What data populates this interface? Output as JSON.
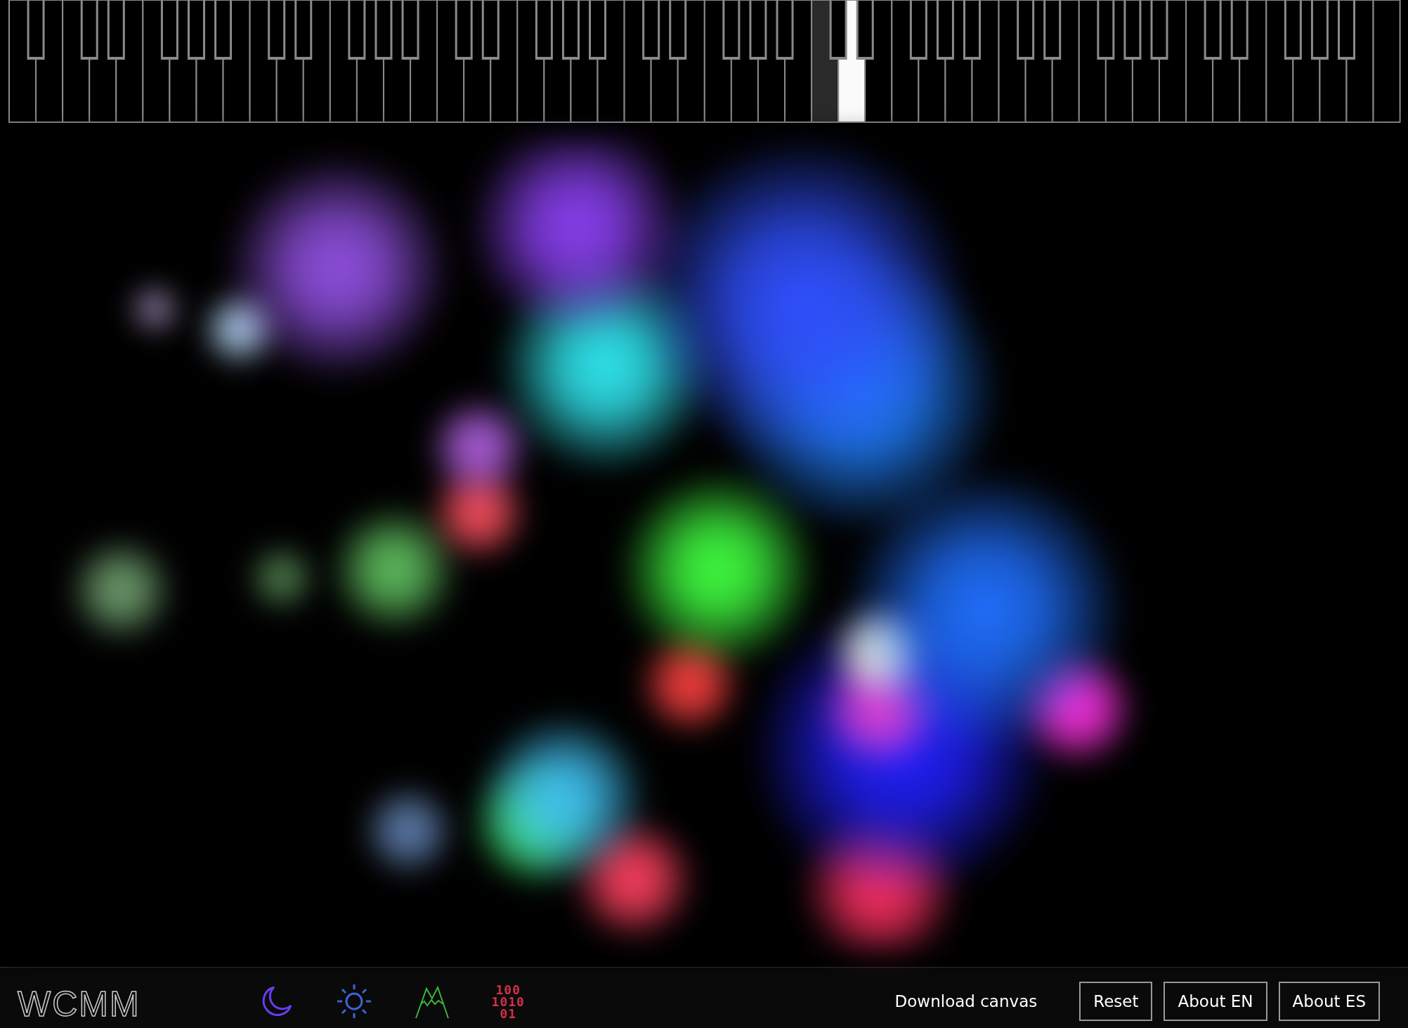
{
  "piano": {
    "keys": [
      {
        "kind": "white",
        "pressed": false,
        "fading": false
      },
      {
        "kind": "black",
        "pressed": false,
        "fading": false
      },
      {
        "kind": "white",
        "pressed": false,
        "fading": false
      },
      {
        "kind": "white",
        "pressed": false,
        "fading": false
      },
      {
        "kind": "black",
        "pressed": false,
        "fading": false
      },
      {
        "kind": "white",
        "pressed": false,
        "fading": false
      },
      {
        "kind": "black",
        "pressed": false,
        "fading": false
      },
      {
        "kind": "white",
        "pressed": false,
        "fading": false
      },
      {
        "kind": "white",
        "pressed": false,
        "fading": false
      },
      {
        "kind": "black",
        "pressed": false,
        "fading": false
      },
      {
        "kind": "white",
        "pressed": false,
        "fading": false
      },
      {
        "kind": "black",
        "pressed": false,
        "fading": false
      },
      {
        "kind": "white",
        "pressed": false,
        "fading": false
      },
      {
        "kind": "black",
        "pressed": false,
        "fading": false
      },
      {
        "kind": "white",
        "pressed": false,
        "fading": false
      },
      {
        "kind": "white",
        "pressed": false,
        "fading": false
      },
      {
        "kind": "black",
        "pressed": false,
        "fading": false
      },
      {
        "kind": "white",
        "pressed": false,
        "fading": false
      },
      {
        "kind": "black",
        "pressed": false,
        "fading": false
      },
      {
        "kind": "white",
        "pressed": false,
        "fading": false
      },
      {
        "kind": "white",
        "pressed": false,
        "fading": false
      },
      {
        "kind": "black",
        "pressed": false,
        "fading": false
      },
      {
        "kind": "white",
        "pressed": false,
        "fading": false
      },
      {
        "kind": "black",
        "pressed": false,
        "fading": false
      },
      {
        "kind": "white",
        "pressed": false,
        "fading": false
      },
      {
        "kind": "black",
        "pressed": false,
        "fading": false
      },
      {
        "kind": "white",
        "pressed": false,
        "fading": false
      },
      {
        "kind": "white",
        "pressed": false,
        "fading": false
      },
      {
        "kind": "black",
        "pressed": false,
        "fading": false
      },
      {
        "kind": "white",
        "pressed": false,
        "fading": false
      },
      {
        "kind": "black",
        "pressed": false,
        "fading": false
      },
      {
        "kind": "white",
        "pressed": false,
        "fading": false
      },
      {
        "kind": "white",
        "pressed": false,
        "fading": false
      },
      {
        "kind": "black",
        "pressed": false,
        "fading": false
      },
      {
        "kind": "white",
        "pressed": false,
        "fading": false
      },
      {
        "kind": "black",
        "pressed": false,
        "fading": false
      },
      {
        "kind": "white",
        "pressed": false,
        "fading": false
      },
      {
        "kind": "black",
        "pressed": false,
        "fading": false
      },
      {
        "kind": "white",
        "pressed": false,
        "fading": false
      },
      {
        "kind": "white",
        "pressed": false,
        "fading": false
      },
      {
        "kind": "black",
        "pressed": false,
        "fading": false
      },
      {
        "kind": "white",
        "pressed": false,
        "fading": false
      },
      {
        "kind": "black",
        "pressed": false,
        "fading": false
      },
      {
        "kind": "white",
        "pressed": false,
        "fading": false
      },
      {
        "kind": "white",
        "pressed": false,
        "fading": false
      },
      {
        "kind": "black",
        "pressed": false,
        "fading": false
      },
      {
        "kind": "white",
        "pressed": false,
        "fading": false
      },
      {
        "kind": "black",
        "pressed": false,
        "fading": false
      },
      {
        "kind": "white",
        "pressed": false,
        "fading": false
      },
      {
        "kind": "black",
        "pressed": false,
        "fading": false
      },
      {
        "kind": "white",
        "pressed": false,
        "fading": false
      },
      {
        "kind": "white",
        "pressed": false,
        "fading": true
      },
      {
        "kind": "black",
        "pressed": false,
        "fading": false
      },
      {
        "kind": "white",
        "pressed": true,
        "fading": false
      },
      {
        "kind": "black",
        "pressed": false,
        "fading": false
      },
      {
        "kind": "white",
        "pressed": false,
        "fading": false
      },
      {
        "kind": "white",
        "pressed": false,
        "fading": false
      },
      {
        "kind": "black",
        "pressed": false,
        "fading": false
      },
      {
        "kind": "white",
        "pressed": false,
        "fading": false
      },
      {
        "kind": "black",
        "pressed": false,
        "fading": false
      },
      {
        "kind": "white",
        "pressed": false,
        "fading": false
      },
      {
        "kind": "black",
        "pressed": false,
        "fading": false
      },
      {
        "kind": "white",
        "pressed": false,
        "fading": false
      },
      {
        "kind": "white",
        "pressed": false,
        "fading": false
      },
      {
        "kind": "black",
        "pressed": false,
        "fading": false
      },
      {
        "kind": "white",
        "pressed": false,
        "fading": false
      },
      {
        "kind": "black",
        "pressed": false,
        "fading": false
      },
      {
        "kind": "white",
        "pressed": false,
        "fading": false
      },
      {
        "kind": "white",
        "pressed": false,
        "fading": false
      },
      {
        "kind": "black",
        "pressed": false,
        "fading": false
      },
      {
        "kind": "white",
        "pressed": false,
        "fading": false
      },
      {
        "kind": "black",
        "pressed": false,
        "fading": false
      },
      {
        "kind": "white",
        "pressed": false,
        "fading": false
      },
      {
        "kind": "black",
        "pressed": false,
        "fading": false
      },
      {
        "kind": "white",
        "pressed": false,
        "fading": false
      },
      {
        "kind": "white",
        "pressed": false,
        "fading": false
      },
      {
        "kind": "black",
        "pressed": false,
        "fading": false
      },
      {
        "kind": "white",
        "pressed": false,
        "fading": false
      },
      {
        "kind": "black",
        "pressed": false,
        "fading": false
      },
      {
        "kind": "white",
        "pressed": false,
        "fading": false
      },
      {
        "kind": "white",
        "pressed": false,
        "fading": false
      },
      {
        "kind": "black",
        "pressed": false,
        "fading": false
      },
      {
        "kind": "white",
        "pressed": false,
        "fading": false
      },
      {
        "kind": "black",
        "pressed": false,
        "fading": false
      },
      {
        "kind": "white",
        "pressed": false,
        "fading": false
      },
      {
        "kind": "black",
        "pressed": false,
        "fading": false
      },
      {
        "kind": "white",
        "pressed": false,
        "fading": false
      },
      {
        "kind": "white",
        "pressed": false,
        "fading": false
      }
    ]
  },
  "footer": {
    "logo": "WCMM",
    "tools": [
      {
        "kind": "moon",
        "color": "#6a3cf0"
      },
      {
        "kind": "sun",
        "color": "#3a64d8"
      },
      {
        "kind": "mountains",
        "color": "#3cb43c"
      },
      {
        "kind": "binary",
        "color": "#d0304a",
        "lines": [
          "100",
          "1010",
          "01"
        ]
      }
    ],
    "download_link": "Download canvas",
    "buttons": [
      "Reset",
      "About EN",
      "About ES"
    ]
  }
}
